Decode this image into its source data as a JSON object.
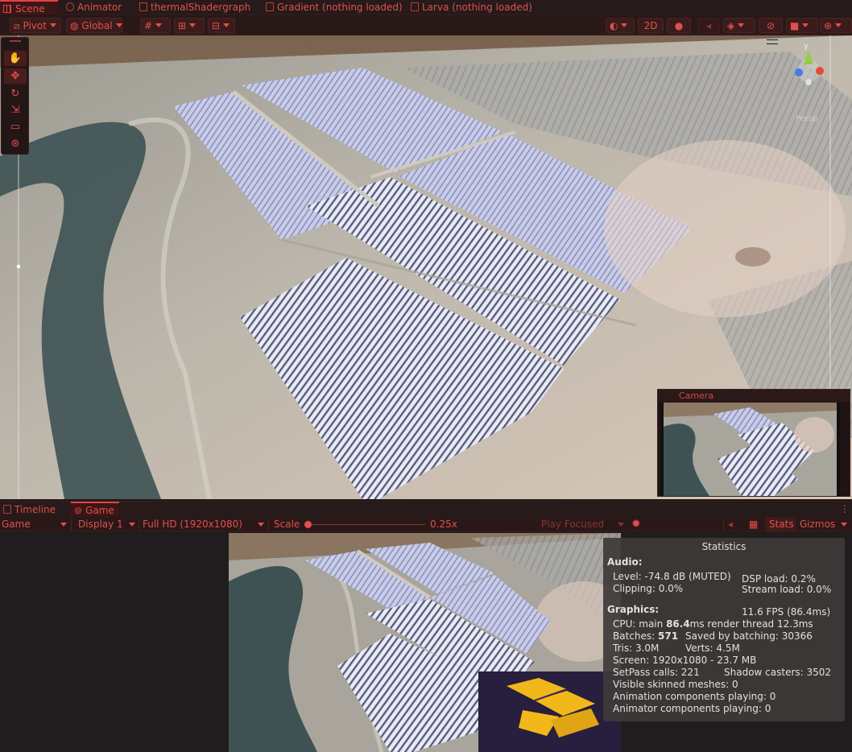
{
  "tabs": [
    {
      "label": "Scene",
      "active": true,
      "icon": "grid-icon"
    },
    {
      "label": "Animator",
      "active": false,
      "icon": "animator-icon"
    },
    {
      "label": "thermalShadergraph",
      "active": false,
      "icon": "shadergraph-icon"
    },
    {
      "label": "Gradient (nothing loaded)",
      "active": false,
      "icon": "shadergraph-icon"
    },
    {
      "label": "Larva (nothing loaded)",
      "active": false,
      "icon": "shadergraph-icon"
    }
  ],
  "toolbar": {
    "pivot": "Pivot",
    "global": "Global",
    "mode_2d": "2D"
  },
  "scene_tools": [
    "hand-tool-icon",
    "move-tool-icon",
    "rotate-tool-icon",
    "scale-tool-icon",
    "rect-tool-icon",
    "transform-tool-icon"
  ],
  "gizmo": {
    "axis_y": "y",
    "persp": "Persp"
  },
  "camera_preview": {
    "title": "Camera"
  },
  "panel_tabs": [
    {
      "label": "Timeline",
      "active": false
    },
    {
      "label": "Game",
      "active": true
    }
  ],
  "game_bar": {
    "mode": "Game",
    "display": "Display 1",
    "resolution": "Full HD (1920x1080)",
    "scale_label": "Scale",
    "scale_value": "0.25x",
    "play_focus": "Play Focused",
    "stats": "Stats",
    "gizmos": "Gizmos"
  },
  "statistics": {
    "title": "Statistics",
    "audio_heading": "Audio:",
    "level": "Level: -74.8 dB (MUTED)",
    "clipping": "Clipping: 0.0%",
    "dsp": "DSP load: 0.2%",
    "stream": "Stream load: 0.0%",
    "graphics_heading": "Graphics:",
    "fps": "11.6 FPS (86.4ms)",
    "cpu_prefix": "CPU: main ",
    "cpu_main": "86.4",
    "cpu_suffix": "ms  render thread 12.3ms",
    "batches_prefix": "Batches: ",
    "batches": "571",
    "saved": "Saved by batching: 30366",
    "tris": "Tris: 3.0M",
    "verts": "Verts: 4.5M",
    "screen": "Screen: 1920x1080 - 23.7 MB",
    "setpass": "SetPass calls: 221",
    "shadow": "Shadow casters: 3502",
    "skinned": "Visible skinned meshes: 0",
    "anim_components": "Animation components playing: 0",
    "animator_components": "Animator components playing: 0"
  },
  "colors": {
    "accent": "#e0504d",
    "panel": "#2a1818",
    "stats_bg": "#3e3a3a",
    "heat": "#f2b81a"
  }
}
